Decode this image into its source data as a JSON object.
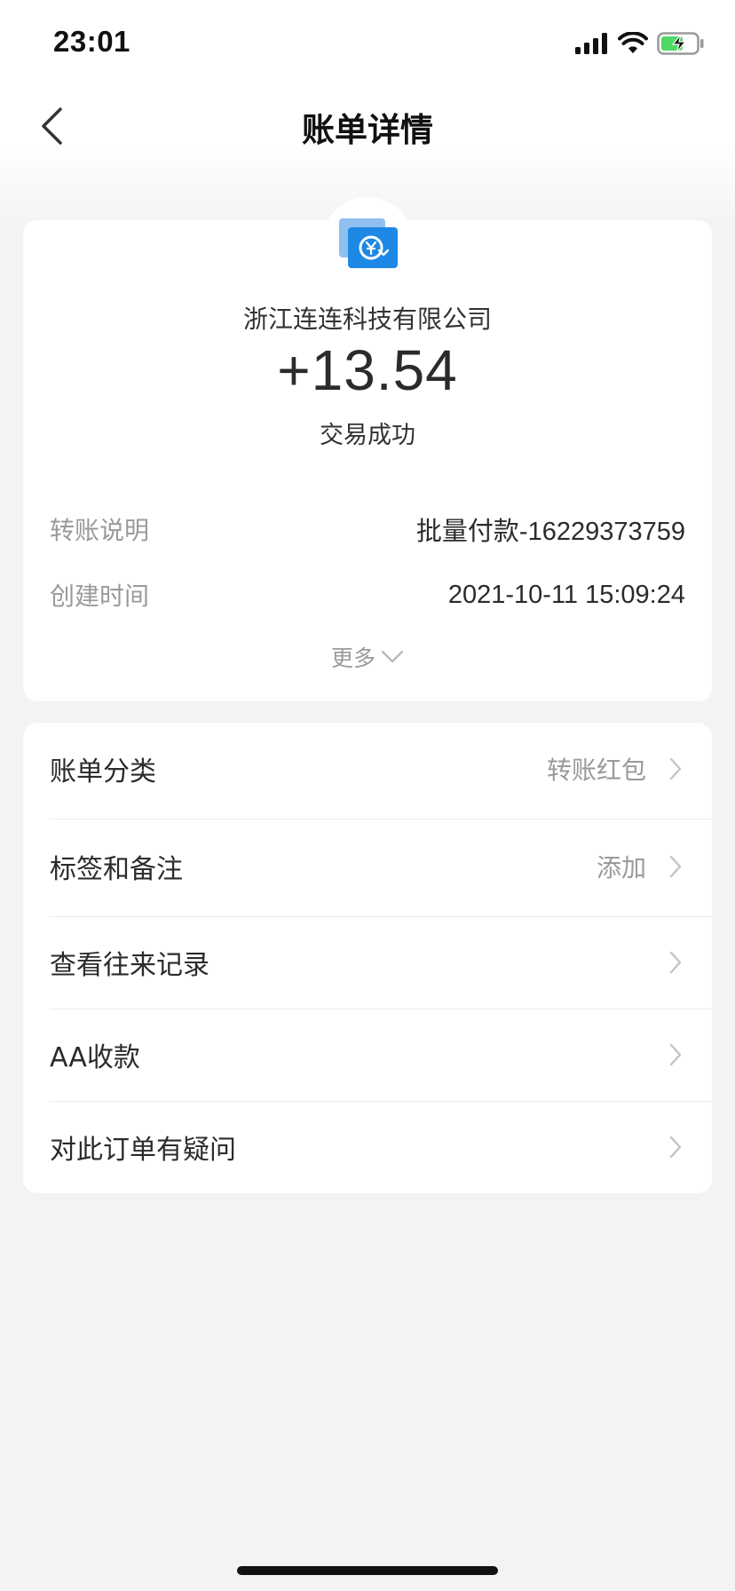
{
  "status_bar": {
    "time": "23:01"
  },
  "nav": {
    "title": "账单详情",
    "back_icon": "chevron-left-icon"
  },
  "summary": {
    "logo_icon": "transfer-yuan-icon",
    "merchant_name": "浙江连连科技有限公司",
    "amount": "+13.54",
    "status": "交易成功",
    "details": [
      {
        "label": "转账说明",
        "value": "批量付款-16229373759"
      },
      {
        "label": "创建时间",
        "value": "2021-10-11 15:09:24"
      }
    ],
    "more_label": "更多"
  },
  "menu": {
    "items": [
      {
        "label": "账单分类",
        "value": "转账红包"
      },
      {
        "label": "标签和备注",
        "value": "添加"
      },
      {
        "label": "查看往来记录",
        "value": ""
      },
      {
        "label": "AA收款",
        "value": ""
      },
      {
        "label": "对此订单有疑问",
        "value": ""
      }
    ]
  },
  "colors": {
    "background": "#f3f3f3",
    "card": "#ffffff",
    "primary_text": "#2b2b2b",
    "secondary_text": "#9a9a9a",
    "logo_blue": "#1e88e5",
    "logo_back": "#7fb7ef",
    "battery_green": "#4cd964"
  }
}
